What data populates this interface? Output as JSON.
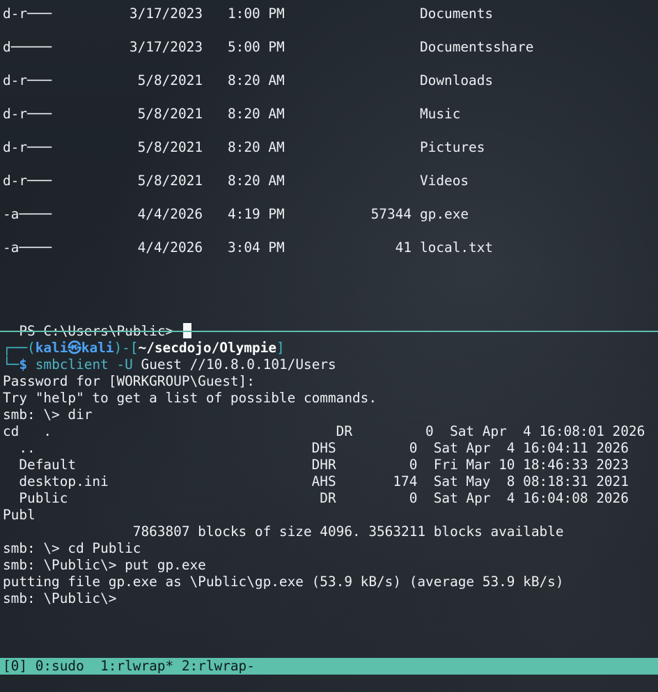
{
  "top_pane": {
    "rows": [
      {
        "mode": "d-r───",
        "date": "3/17/2023",
        "time": "1:00 PM",
        "size": "",
        "name": "Documents"
      },
      {
        "mode": "d─────",
        "date": "3/17/2023",
        "time": "5:00 PM",
        "size": "",
        "name": "Documentsshare"
      },
      {
        "mode": "d-r───",
        "date": "5/8/2021",
        "time": "8:20 AM",
        "size": "",
        "name": "Downloads"
      },
      {
        "mode": "d-r───",
        "date": "5/8/2021",
        "time": "8:20 AM",
        "size": "",
        "name": "Music"
      },
      {
        "mode": "d-r───",
        "date": "5/8/2021",
        "time": "8:20 AM",
        "size": "",
        "name": "Pictures"
      },
      {
        "mode": "d-r───",
        "date": "5/8/2021",
        "time": "8:20 AM",
        "size": "",
        "name": "Videos"
      },
      {
        "mode": "-a────",
        "date": "4/4/2026",
        "time": "4:19 PM",
        "size": "57344",
        "name": "gp.exe"
      },
      {
        "mode": "-a────",
        "date": "4/4/2026",
        "time": "3:04 PM",
        "size": "41",
        "name": "local.txt"
      }
    ],
    "ps_prompt": "PS C:\\Users\\Public> "
  },
  "bottom_pane": {
    "prompt_line1_open": "┌──(",
    "user": "kali",
    "host_symbol": "㉿",
    "host": "kali",
    "prompt_mid": ")-[",
    "path": "~/secdojo/Olympie",
    "prompt_close": "]",
    "prompt_line2_prefix": "└─",
    "dollar": "$",
    "command_name": "smbclient",
    "command_flag": "-U",
    "command_rest": "Guest //10.8.0.101/Users",
    "lines": [
      "Password for [WORKGROUP\\Guest]:",
      "Try \"help\" to get a list of possible commands.",
      "smb: \\> dir",
      "cd   .                                   DR         0  Sat Apr  4 16:08:01 2026",
      "  ..                                  DHS         0  Sat Apr  4 16:04:11 2026",
      "  Default                             DHR         0  Fri Mar 10 18:46:33 2023",
      "  desktop.ini                         AHS       174  Sat May  8 08:18:31 2021",
      "  Public                               DR         0  Sat Apr  4 16:04:08 2026",
      "Publ",
      "                7863807 blocks of size 4096. 3563211 blocks available",
      "smb: \\> cd Public",
      "smb: \\Public\\> put gp.exe",
      "putting file gp.exe as \\Public\\gp.exe (53.9 kB/s) (average 53.9 kB/s)",
      "smb: \\Public\\>"
    ]
  },
  "status_bar": {
    "text": "[0] 0:sudo  1:rlwrap* 2:rlwrap-"
  }
}
